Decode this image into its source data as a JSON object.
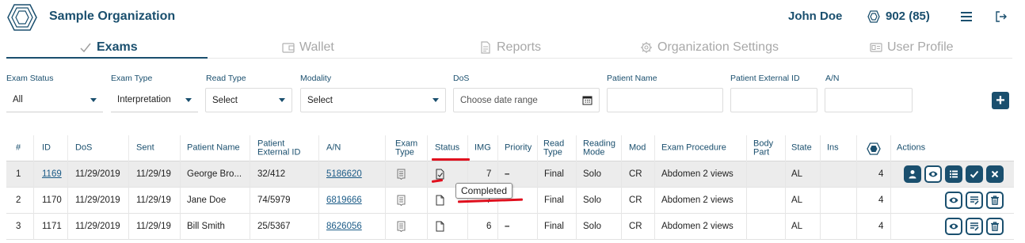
{
  "header": {
    "org_name": "Sample Organization",
    "user_name": "John Doe",
    "credits": "902 (85)"
  },
  "tabs": [
    {
      "label": "Exams",
      "icon": "check-icon",
      "active": true
    },
    {
      "label": "Wallet",
      "icon": "wallet-icon",
      "active": false
    },
    {
      "label": "Reports",
      "icon": "report-icon",
      "active": false
    },
    {
      "label": "Organization Settings",
      "icon": "gear-icon",
      "active": false
    },
    {
      "label": "User Profile",
      "icon": "id-card-icon",
      "active": false
    }
  ],
  "filters": {
    "exam_status": {
      "label": "Exam Status",
      "value": "All"
    },
    "exam_type": {
      "label": "Exam Type",
      "value": "Interpretation"
    },
    "read_type": {
      "label": "Read Type",
      "value": "Select"
    },
    "modality": {
      "label": "Modality",
      "value": "Select"
    },
    "dos": {
      "label": "DoS",
      "placeholder": "Choose date range"
    },
    "patient_name": {
      "label": "Patient Name",
      "value": ""
    },
    "patient_external_id": {
      "label": "Patient External ID",
      "value": ""
    },
    "an": {
      "label": "A/N",
      "value": ""
    },
    "add_label": "+"
  },
  "table": {
    "headers": {
      "num": "#",
      "id": "ID",
      "dos": "DoS",
      "sent": "Sent",
      "patient_name": "Patient Name",
      "patient_ext_1": "Patient",
      "patient_ext_2": "External ID",
      "an": "A/N",
      "exam_type_1": "Exam",
      "exam_type_2": "Type",
      "status": "Status",
      "img": "IMG",
      "priority": "Priority",
      "read_type_1": "Read",
      "read_type_2": "Type",
      "reading_mode_1": "Reading",
      "reading_mode_2": "Mode",
      "mod": "Mod",
      "exam_procedure": "Exam Procedure",
      "body_part_1": "Body",
      "body_part_2": "Part",
      "state": "State",
      "ins": "Ins",
      "actions": "Actions"
    },
    "rows": [
      {
        "num": "1",
        "id": "1169",
        "dos": "11/29/2019",
        "sent": "11/29/19",
        "patient_name": "George Bro...",
        "patient_ext_id": "32/412",
        "an": "5186620",
        "img": "7",
        "priority": "–",
        "read_type": "Final",
        "reading_mode": "Solo",
        "mod": "CR",
        "exam_procedure": "Abdomen 2 views",
        "state": "AL",
        "count": "4"
      },
      {
        "num": "2",
        "id": "1170",
        "dos": "11/29/2019",
        "sent": "11/29/19",
        "patient_name": "Jane Doe",
        "patient_ext_id": "74/5979",
        "an": "6819666",
        "img": "7",
        "priority": "–",
        "read_type": "Final",
        "reading_mode": "Solo",
        "mod": "CR",
        "exam_procedure": "Abdomen 2 views",
        "state": "AL",
        "count": "4"
      },
      {
        "num": "3",
        "id": "1171",
        "dos": "11/29/2019",
        "sent": "11/29/19",
        "patient_name": "Bill Smith",
        "patient_ext_id": "25/5367",
        "an": "8626056",
        "img": "6",
        "priority": "–",
        "read_type": "Final",
        "reading_mode": "Solo",
        "mod": "CR",
        "exam_procedure": "Abdomen 2 views",
        "state": "AL",
        "count": "4"
      }
    ]
  },
  "tooltip": "Completed",
  "colors": {
    "brand": "#1a4f6e",
    "annotation": "#e0101e",
    "row_highlight": "#ececec"
  }
}
